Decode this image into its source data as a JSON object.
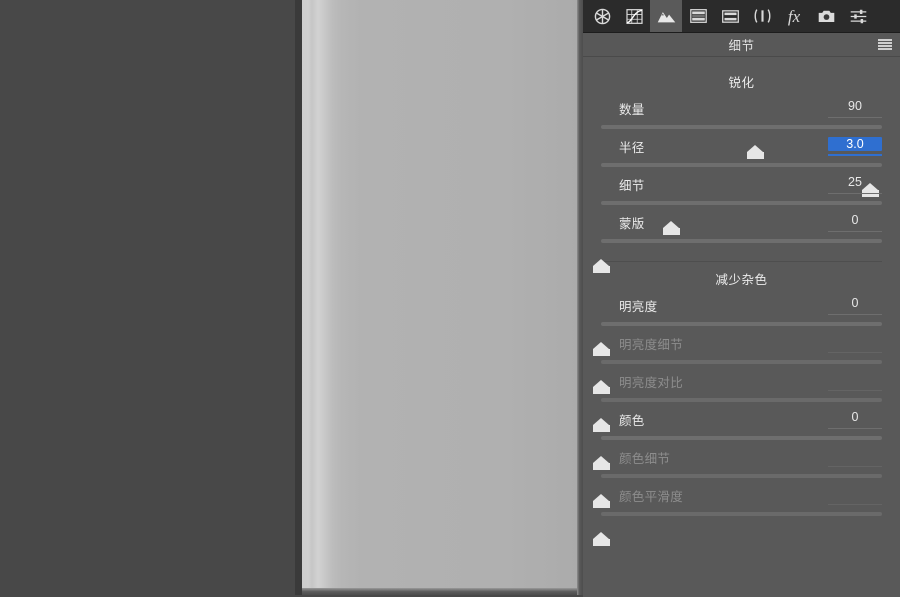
{
  "app": {
    "background_color": "#484848",
    "panel_color": "#595959",
    "accent_color": "#2f6fd0"
  },
  "toolbar": {
    "items": [
      {
        "icon": "aperture-icon",
        "label": "基本",
        "active": false
      },
      {
        "icon": "tone-curve-icon",
        "label": "色调曲线",
        "active": false
      },
      {
        "icon": "detail-icon",
        "label": "细节",
        "active": true
      },
      {
        "icon": "hsl-grayscale-icon",
        "label": "HSL/灰度",
        "active": false
      },
      {
        "icon": "split-toning-icon",
        "label": "分离色调",
        "active": false
      },
      {
        "icon": "lens-correction-icon",
        "label": "镜头校正",
        "active": false
      },
      {
        "icon": "effects-fx-icon",
        "label": "效果",
        "active": false
      },
      {
        "icon": "camera-calibration-icon",
        "label": "相机校准",
        "active": false
      },
      {
        "icon": "presets-sliders-icon",
        "label": "预设",
        "active": false
      }
    ]
  },
  "panel": {
    "title": "细节",
    "menu_icon": "hamburger-menu-icon"
  },
  "sharpening": {
    "heading": "锐化",
    "rows": [
      {
        "label": "数量",
        "value": "90",
        "percent": 55,
        "state": "normal"
      },
      {
        "label": "半径",
        "value": "3.0",
        "percent": 96,
        "state": "active"
      },
      {
        "label": "细节",
        "value": "25",
        "percent": 25,
        "state": "normal"
      },
      {
        "label": "蒙版",
        "value": "0",
        "percent": 0,
        "state": "normal"
      }
    ]
  },
  "noise_reduction": {
    "heading": "减少杂色",
    "rows": [
      {
        "label": "明亮度",
        "value": "0",
        "percent": 0,
        "state": "normal"
      },
      {
        "label": "明亮度细节",
        "value": "",
        "percent": 0,
        "state": "disabled"
      },
      {
        "label": "明亮度对比",
        "value": "",
        "percent": 0,
        "state": "disabled"
      },
      {
        "label": "颜色",
        "value": "0",
        "percent": 0,
        "state": "normal"
      },
      {
        "label": "颜色细节",
        "value": "",
        "percent": 0,
        "state": "disabled"
      },
      {
        "label": "颜色平滑度",
        "value": "",
        "percent": 0,
        "state": "disabled"
      }
    ]
  }
}
